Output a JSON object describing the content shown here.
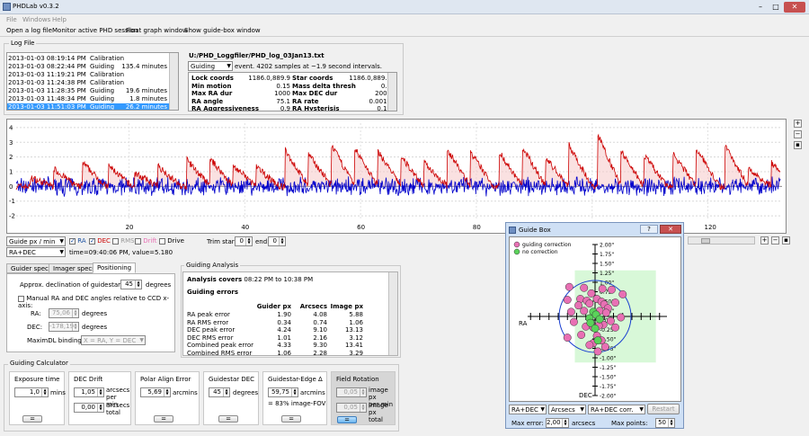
{
  "window": {
    "title": "PHDLab v0.3.2"
  },
  "menu": [
    "File",
    "Windows",
    "Help"
  ],
  "toolbar": [
    "Open a log file",
    "Monitor active PHD session",
    "Float graph window",
    "Show guide-box window"
  ],
  "log_file": {
    "group_label": "Log File",
    "rows": [
      {
        "time": "2013-01-03 08:19:14 PM",
        "type": "Calibration",
        "dur": ""
      },
      {
        "time": "2013-01-03 08:22:44 PM",
        "type": "Guiding",
        "dur": "135.4 minutes"
      },
      {
        "time": "2013-01-03 11:19:21 PM",
        "type": "Calibration",
        "dur": ""
      },
      {
        "time": "2013-01-03 11:24:38 PM",
        "type": "Calibration",
        "dur": ""
      },
      {
        "time": "2013-01-03 11:28:35 PM",
        "type": "Guiding",
        "dur": "19.6 minutes"
      },
      {
        "time": "2013-01-03 11:48:34 PM",
        "type": "Guiding",
        "dur": "1.8 minutes"
      },
      {
        "time": "2013-01-03 11:51:03 PM",
        "type": "Guiding",
        "dur": "26.2 minutes"
      }
    ],
    "path": "U:/PHD_Loggfiler/PHD_log_03Jan13.txt",
    "event_type": "Guiding",
    "event_summary": "event. 4202 samples at ~1.9 second intervals.",
    "stats": [
      [
        "Lock coords",
        "1186.0,889.9",
        "Star coords",
        "1186.0,889.9"
      ],
      [
        "Min motion",
        "0.15",
        "Mass delta thresh",
        "0.5"
      ],
      [
        "Max RA dur",
        "1000",
        "Max DEC dur",
        "2000"
      ],
      [
        "RA angle",
        "75.1",
        "RA rate",
        "0.0015"
      ],
      [
        "RA Aggressiveness",
        "0.9",
        "RA Hysterisis",
        "0.12"
      ]
    ]
  },
  "graph": {
    "y_ticks": [
      "4",
      "3",
      "2",
      "1",
      "0",
      "-1",
      "-2"
    ],
    "x_ticks": [
      "20",
      "40",
      "60",
      "80",
      "100",
      "120"
    ],
    "series_colors": {
      "ra": "#cc0000",
      "dec": "#0000cc"
    }
  },
  "graph_controls": {
    "scale": "Guide px / min",
    "axis": "RA+DEC",
    "ra": "RA",
    "dec": "DEC",
    "rms": "RMS",
    "drift": "Drift",
    "drive": "Drive",
    "trim_start_label": "Trim start:",
    "trim_start": "0",
    "trim_end_label": "end:",
    "trim_end": "0",
    "cursor": "time=09:40:06 PM, value=5.180"
  },
  "tabs": [
    "Guider specs",
    "Imager specs",
    "Positioning"
  ],
  "positioning": {
    "decl_label": "Approx. declination of guidestar:",
    "decl_value": "45",
    "decl_unit": "degrees",
    "manual_label": "Manual RA and DEC angles relative to CCD x-axis:",
    "ra_label": "RA:",
    "ra_value": "75,06",
    "ra_unit": "degrees",
    "dec_label": "DEC:",
    "dec_value": "-178,19",
    "dec_unit": "degrees",
    "maxim_label": "MaximDL bindings:",
    "maxim_value": "X = RA, Y = DEC"
  },
  "analysis": {
    "group_label": "Guiding Analysis",
    "covers_label": "Analysis covers",
    "covers_rest": "08:22 PM to 10:38 PM",
    "errors_title": "Guiding errors",
    "headers": [
      "Guider px",
      "Arcsecs",
      "Image px"
    ],
    "rows": [
      [
        "RA peak error",
        "1.90",
        "4.08",
        "5.88"
      ],
      [
        "RA RMS error",
        "0.34",
        "0.74",
        "1.06"
      ],
      [
        "DEC peak error",
        "4.24",
        "9.10",
        "13.13"
      ],
      [
        "DEC RMS error",
        "1.01",
        "2.16",
        "3.12"
      ],
      [
        "Combined peak error",
        "4.33",
        "9.30",
        "13.41"
      ],
      [
        "Combined RMS error",
        "1.06",
        "2.28",
        "3.29"
      ]
    ]
  },
  "calculator": {
    "group_label": "Guiding Calculator",
    "exposure": {
      "title": "Exposure time",
      "value": "1,0",
      "unit": "mins"
    },
    "dec_drift": {
      "title": "DEC Drift",
      "v1": "1,05",
      "u1a": "arcsecs",
      "u1b": "per min",
      "v2": "0,00",
      "u2a": "arcsecs",
      "u2b": "total"
    },
    "polar": {
      "title": "Polar Align Error",
      "value": "5,69",
      "unit": "arcmins"
    },
    "guidestar_dec": {
      "title": "Guidestar DEC",
      "value": "45",
      "unit": "degrees"
    },
    "edge": {
      "title": "Guidestar-Edge Δ",
      "value": "59,75",
      "unit": "arcmins",
      "note": "= 83% image-FOV"
    },
    "field_rot": {
      "title": "Field Rotation",
      "v1": "0,05",
      "u1a": "image px",
      "u1b": "per min",
      "v2": "0,05",
      "u2a": "image px",
      "u2b": "total"
    },
    "eq": "="
  },
  "guide_box": {
    "title": "Guide Box",
    "legend_guiding": "guiding correction",
    "legend_nocorr": "no correction",
    "y_labels": [
      "2.00\"",
      "1.75\"",
      "1.50\"",
      "1.25\"",
      "1.00\"",
      "0.75\"",
      "0.50\"",
      "0.25\"",
      "0.00\"",
      "-0.25\"",
      "-0.50\"",
      "-0.75\"",
      "-1.00\"",
      "-1.25\"",
      "-1.50\"",
      "-1.75\"",
      "-2.00\""
    ],
    "ra_label": "RA",
    "dec_label": "DEC",
    "combo1": "RA+DEC",
    "combo2": "Arcsecs",
    "combo3": "RA+DEC corr.",
    "restart": "Restart",
    "max_error_label": "Max error:",
    "max_error": "2,00",
    "max_error_unit": "arcsecs",
    "max_points_label": "Max points:",
    "max_points": "50",
    "colors": {
      "guiding": "#e870b4",
      "nocorr": "#5ad35a"
    }
  }
}
